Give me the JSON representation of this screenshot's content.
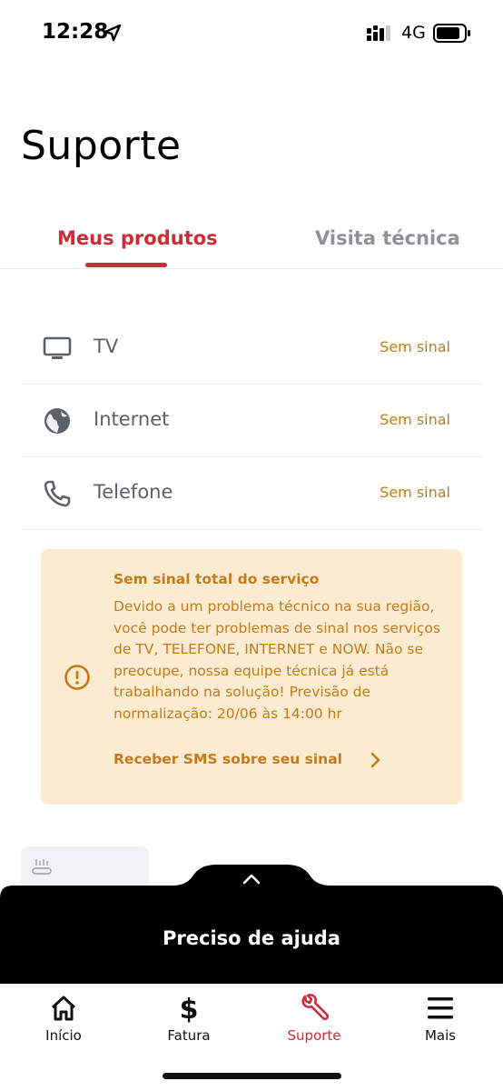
{
  "status_bar": {
    "time": "12:28",
    "network": "4G",
    "icons": [
      "location-arrow-icon",
      "signal-bars-icon",
      "battery-icon"
    ]
  },
  "page": {
    "title": "Suporte"
  },
  "tabs": [
    {
      "label": "Meus produtos",
      "active": true
    },
    {
      "label": "Visita técnica",
      "active": false
    }
  ],
  "products": [
    {
      "name": "TV",
      "status": "Sem sinal",
      "icon": "tv-icon"
    },
    {
      "name": "Internet",
      "status": "Sem sinal",
      "icon": "globe-icon"
    },
    {
      "name": "Telefone",
      "status": "Sem sinal",
      "icon": "phone-icon"
    }
  ],
  "alert": {
    "icon": "alert-circle-icon",
    "title": "Sem sinal total do serviço",
    "body": "Devido a um problema técnico na sua região, você pode ter problemas de sinal nos serviços de TV, TELEFONE, INTERNET e NOW. Não se preocupe, nossa equipe técnica já está trabalhando na solução! Previsão de normalização: 20/06 às 14:00 hr",
    "link_label": "Receber SMS sobre seu sinal"
  },
  "help_panel": {
    "label": "Preciso de ajuda"
  },
  "bottom_nav": [
    {
      "label": "Início",
      "icon": "home-icon",
      "active": false
    },
    {
      "label": "Fatura",
      "icon": "dollar-icon",
      "active": false
    },
    {
      "label": "Suporte",
      "icon": "wrench-icon",
      "active": true
    },
    {
      "label": "Mais",
      "icon": "menu-icon",
      "active": false
    }
  ],
  "colors": {
    "accent_red": "#cf2a36",
    "warning_orange": "#c47a1b",
    "alert_background": "#fbecd1"
  }
}
